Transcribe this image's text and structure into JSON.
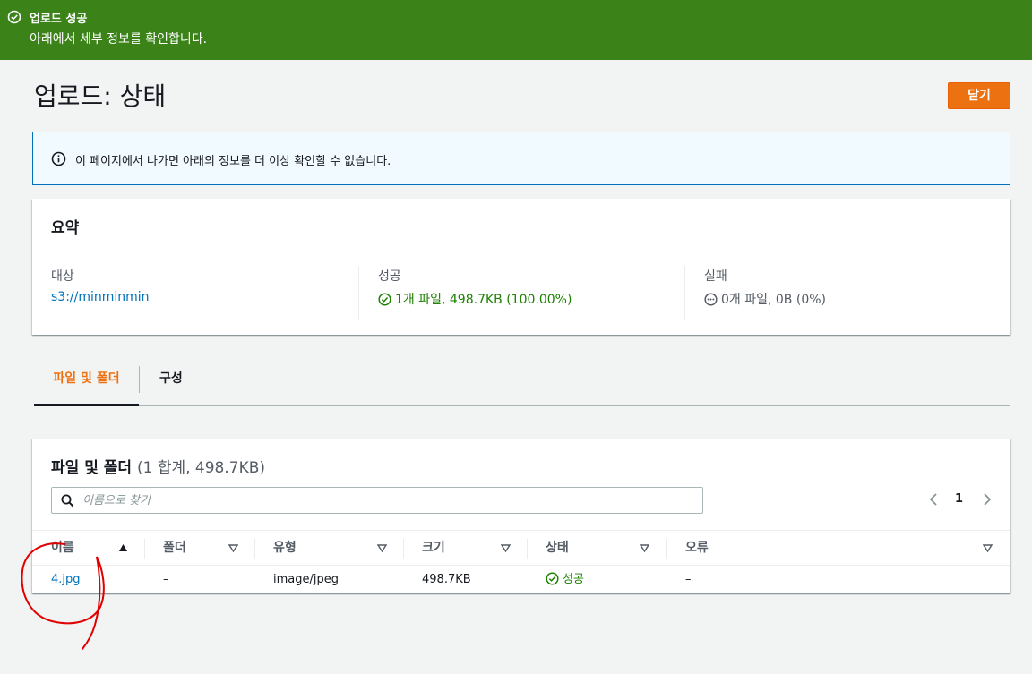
{
  "flash": {
    "title": "업로드 성공",
    "message": "아래에서 세부 정보를 확인합니다.",
    "icon": "check-circle-icon"
  },
  "header": {
    "title": "업로드: 상태",
    "close_label": "닫기"
  },
  "info": {
    "icon": "info-circle-icon",
    "message": "이 페이지에서 나가면 아래의 정보를 더 이상 확인할 수 없습니다."
  },
  "summary": {
    "title": "요약",
    "destination": {
      "label": "대상",
      "value": "s3://minminmin"
    },
    "succeeded": {
      "label": "성공",
      "value": "1개 파일, 498.7KB (100.00%)"
    },
    "failed": {
      "label": "실패",
      "value": "0개 파일, 0B (0%)"
    }
  },
  "tabs": [
    {
      "label": "파일 및 폴더",
      "active": true
    },
    {
      "label": "구성",
      "active": false
    }
  ],
  "files": {
    "title": "파일 및 폴더",
    "count": "(1 합계, 498.7KB)",
    "search_placeholder": "이름으로 찾기",
    "page": "1",
    "columns": [
      "이름",
      "폴더",
      "유형",
      "크기",
      "상태",
      "오류"
    ],
    "rows": [
      {
        "name": "4.jpg",
        "folder": "–",
        "type": "image/jpeg",
        "size": "498.7KB",
        "status": "성공",
        "error": "–"
      }
    ]
  },
  "colors": {
    "flash_bg": "#3b8319",
    "accent_orange": "#ec7211",
    "link_blue": "#0073bb",
    "success_green": "#1d8102",
    "annotation_red": "#e00000"
  }
}
